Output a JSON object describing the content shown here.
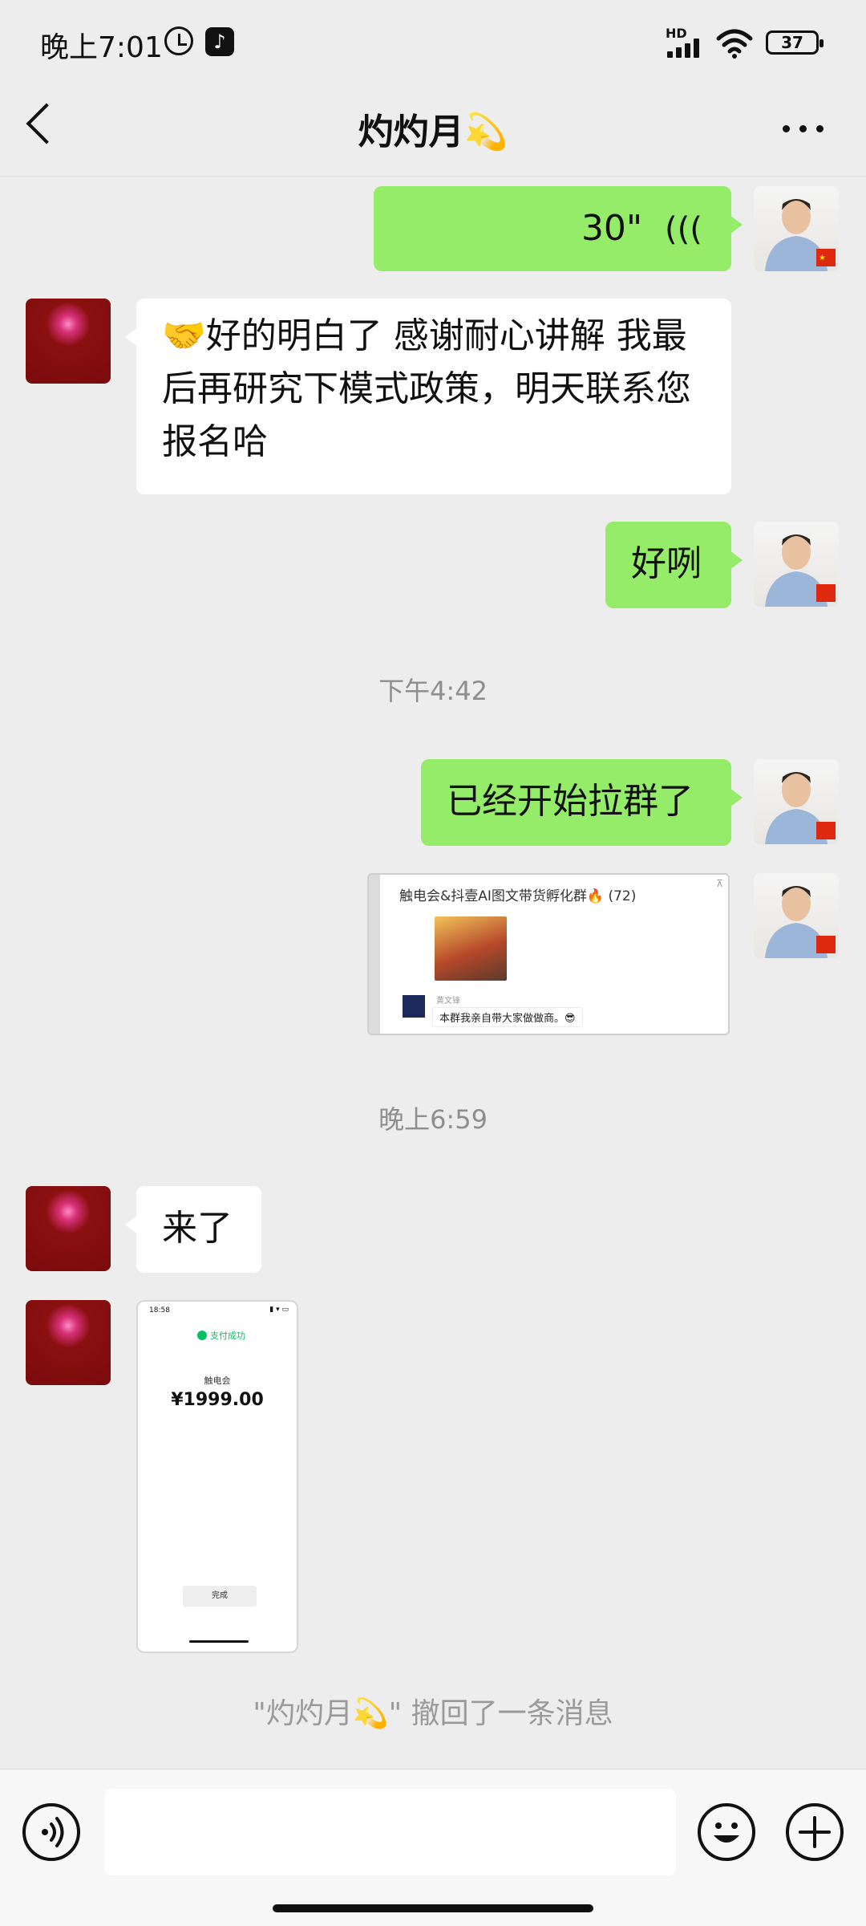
{
  "status_bar": {
    "time": "晚上7:01",
    "network": "HD",
    "battery": "37",
    "tiktok_glyph": "♪"
  },
  "chat": {
    "title": "灼灼月💫"
  },
  "messages": {
    "voice_duration": "30\"",
    "her_reply_1": "🤝好的明白了 感谢耐心讲解 我最后再研究下模式政策，明天联系您报名哈",
    "my_reply_1": "好咧",
    "timestamp_1": "下午4:42",
    "my_reply_2": "已经开始拉群了",
    "group_screenshot": {
      "group_title": "触电会&抖壹AI图文带货孵化群🔥 (72)",
      "sender_name": "黄文锋",
      "message": "本群我亲自带大家做做商。😎"
    },
    "timestamp_2": "晚上6:59",
    "her_reply_2": "来了",
    "payment_screenshot": {
      "time": "18:58",
      "status": "支付成功",
      "payee": "触电会",
      "amount": "¥1999.00",
      "done_button": "完成"
    },
    "recall_notice": "\"灼灼月💫\" 撤回了一条消息"
  },
  "icons": {
    "back": "back-chevron-icon",
    "more": "more-dots-icon",
    "voice": "voice-input-icon",
    "emoji": "emoji-icon",
    "plus": "plus-icon"
  },
  "colors": {
    "my_bubble": "#95ec69",
    "her_bubble": "#ffffff",
    "background": "#ededed"
  }
}
